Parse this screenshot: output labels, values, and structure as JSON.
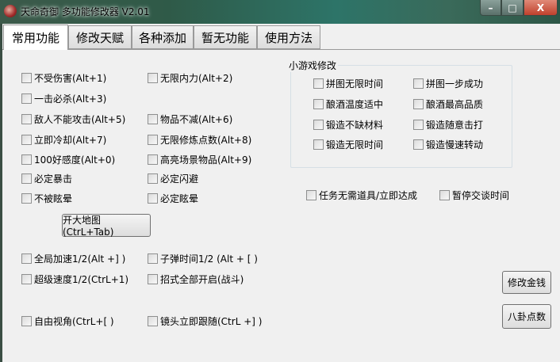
{
  "window": {
    "title": "天命奇御 多功能修改器  V2.01",
    "minimize": "–",
    "maximize": "□",
    "close": "X"
  },
  "tabs": [
    "常用功能",
    "修改天赋",
    "各种添加",
    "暂无功能",
    "使用方法"
  ],
  "main": {
    "col1": [
      "不受伤害(Alt+1)",
      "一击必杀(Alt+3)",
      "敌人不能攻击(Alt+5)",
      "立即冷却(Alt+7)",
      "100好感度(Alt+0)",
      "必定暴击",
      "不被眩晕"
    ],
    "col2": [
      "无限内力(Alt+2)",
      "物品不减(Alt+6)",
      "无限修炼点数(Alt+8)",
      "高亮场景物品(Alt+9)",
      "必定闪避",
      "必定眩晕"
    ],
    "open_map_button": "开大地图(CtrL+Tab)",
    "bottom": [
      "全局加速1/2(Alt +] )",
      "子弹时间1/2 (Alt + [ )",
      "超级速度1/2(CtrL+1)",
      "招式全部开启(战斗)",
      "自由视角(CtrL+[ )",
      "镜头立即跟随(CtrL +] )"
    ],
    "minigame": {
      "title": "小游戏修改",
      "items": [
        "拼图无限时间",
        "拼图一步成功",
        "酿酒温度适中",
        "酿酒最高品质",
        "锻造不缺材料",
        "锻造随意击打",
        "锻造无限时间",
        "锻造慢速转动"
      ]
    },
    "quest_no_items": "任务无需道具/立即达成",
    "pause_dialog": "暂停交谈时间",
    "modify_money_button": "修改金钱",
    "bagua_button": "八卦点数"
  }
}
